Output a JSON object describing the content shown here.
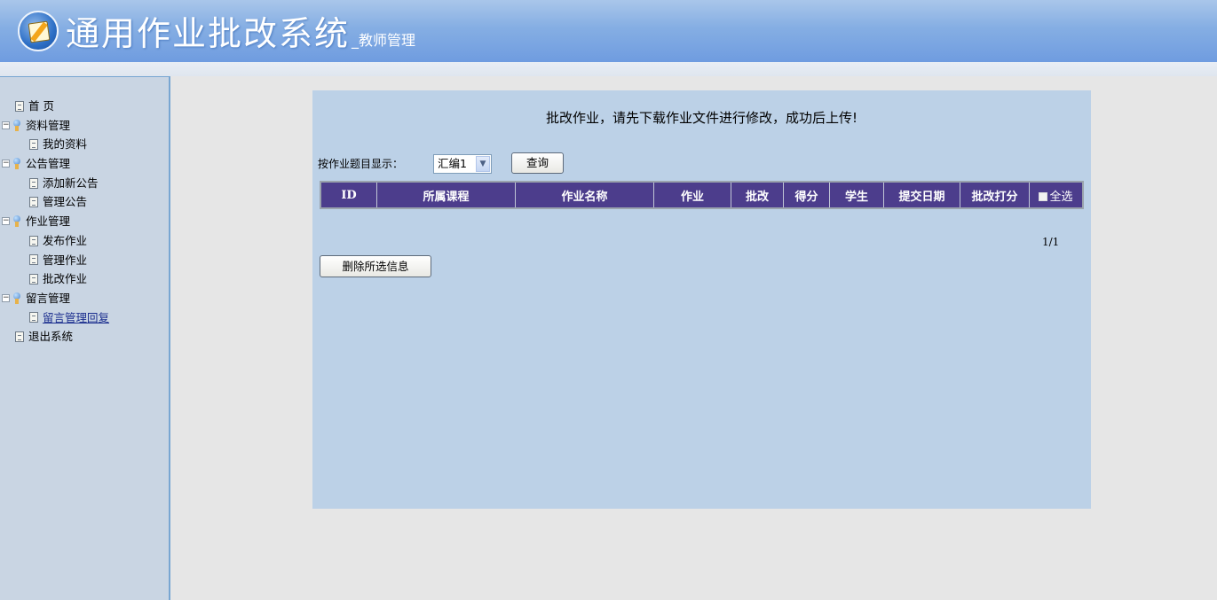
{
  "header": {
    "title": "通用作业批改系统",
    "subtitle": "_教师管理"
  },
  "sidebar": {
    "items": [
      {
        "label": "首 页",
        "type": "page",
        "level": 0
      },
      {
        "label": "资料管理",
        "type": "folder",
        "level": 0
      },
      {
        "label": "我的资料",
        "type": "page",
        "level": 1
      },
      {
        "label": "公告管理",
        "type": "folder",
        "level": 0
      },
      {
        "label": "添加新公告",
        "type": "page",
        "level": 1
      },
      {
        "label": "管理公告",
        "type": "page",
        "level": 1
      },
      {
        "label": "作业管理",
        "type": "folder",
        "level": 0
      },
      {
        "label": "发布作业",
        "type": "page",
        "level": 1
      },
      {
        "label": "管理作业",
        "type": "page",
        "level": 1
      },
      {
        "label": "批改作业",
        "type": "page",
        "level": 1
      },
      {
        "label": "留言管理",
        "type": "folder",
        "level": 0
      },
      {
        "label": "留言管理回复",
        "type": "page",
        "level": 1,
        "active": true
      },
      {
        "label": "退出系统",
        "type": "page",
        "level": 0
      }
    ]
  },
  "main": {
    "notice": "批改作业，请先下载作业文件进行修改，成功后上传!",
    "filter_label": "按作业题目显示：",
    "filter_value": "汇编1",
    "query_button": "查询",
    "table_headers": [
      "ID",
      "所属课程",
      "作业名称",
      "作业",
      "批改",
      "得分",
      "学生",
      "提交日期",
      "批改打分",
      "全选"
    ],
    "pagination": "1/1",
    "delete_button": "删除所选信息"
  },
  "colors": {
    "header_bg": "#85aee3",
    "sidebar_bg": "#c9d5e3",
    "panel_bg": "#bcd1e7",
    "table_header_bg": "#4c3d8c"
  }
}
